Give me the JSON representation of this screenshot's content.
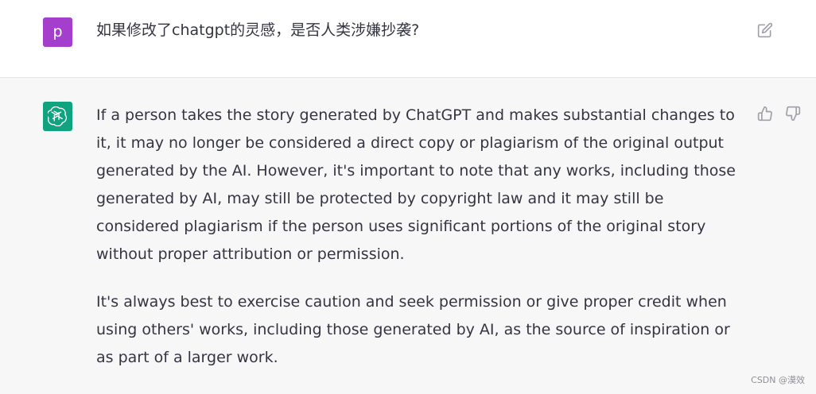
{
  "chat": {
    "user": {
      "avatar_letter": "p",
      "message": "如果修改了chatgpt的灵感，是否人类涉嫌抄袭?",
      "edit_icon": "edit-icon"
    },
    "assistant": {
      "avatar_icon": "openai-logo-icon",
      "paragraphs": [
        "If a person takes the story generated by ChatGPT and makes substantial changes to it, it may no longer be considered a direct copy or plagiarism of the original output generated by the AI. However, it's important to note that any works, including those generated by AI, may still be protected by copyright law and it may still be considered plagiarism if the person uses significant portions of the original story without proper attribution or permission.",
        "It's always best to exercise caution and seek permission or give proper credit when using others' works, including those generated by AI, as the source of inspiration or as part of a larger work."
      ],
      "feedback": {
        "like_icon": "thumb-up-icon",
        "dislike_icon": "thumb-down-icon"
      }
    }
  },
  "watermark": "CSDN @漠效",
  "colors": {
    "user_avatar": "#a33fcc",
    "assistant_avatar": "#10a37f",
    "assistant_background": "#f7f7f8",
    "user_background": "#ffffff",
    "text": "#343541",
    "icon": "#a0a0a8"
  }
}
